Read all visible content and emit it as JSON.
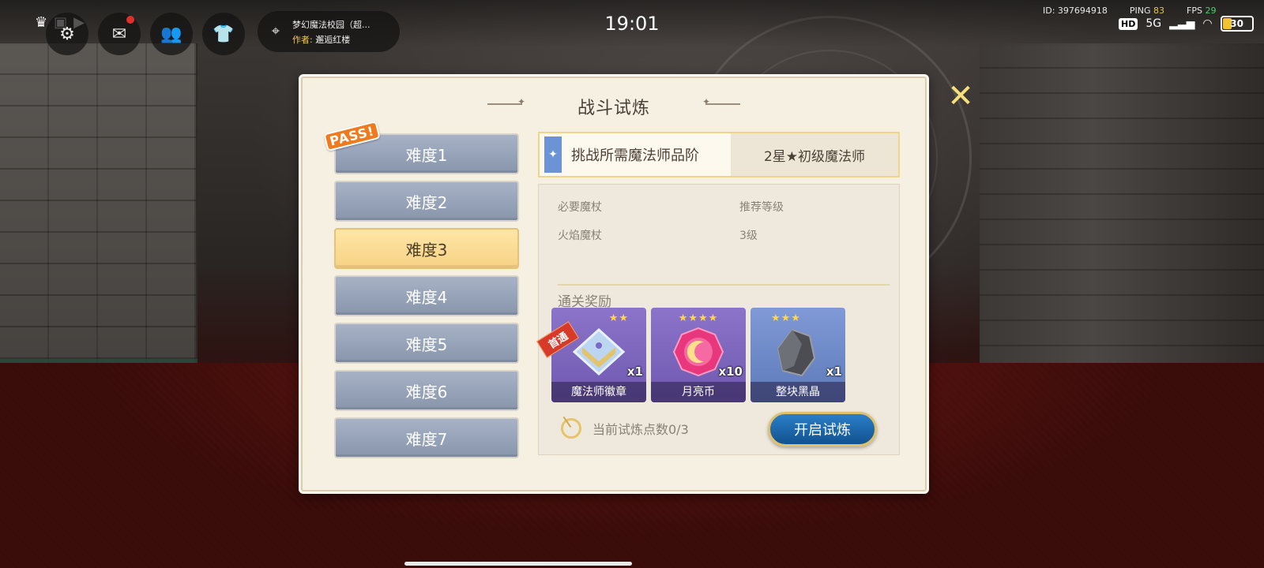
{
  "status_bar": {
    "clock": "19:01",
    "user_id": "ID: 397694918",
    "ping_label": "PING",
    "ping_value": "83",
    "fps_label": "FPS",
    "fps_value": "29",
    "network": "5G",
    "hd_badge": "HD",
    "battery": "30"
  },
  "map_info": {
    "map_name": "梦幻魔法校园（超...",
    "author_key": "作者:",
    "author_name": "邂逅红楼"
  },
  "panel": {
    "title": "战斗试炼",
    "pass_badge": "PASS!",
    "difficulties": [
      "难度1",
      "难度2",
      "难度3",
      "难度4",
      "难度5",
      "难度6",
      "难度7"
    ],
    "selected_index": 2,
    "requirement_label": "挑战所需魔法师品阶",
    "requirement_value": "2星★初级魔法师",
    "info": {
      "required_wand_label": "必要魔杖",
      "recommended_level_label": "推荐等级",
      "required_wand_value": "火焰魔杖",
      "recommended_level_value": "3级"
    },
    "rewards_title": "通关奖励",
    "rewards": [
      {
        "name": "魔法师徽章",
        "count": "x1",
        "stars": "★★",
        "first_clear": "首通"
      },
      {
        "name": "月亮币",
        "count": "x10",
        "stars": "★★★★"
      },
      {
        "name": "整块黑晶",
        "count": "x1",
        "stars": "★★★"
      }
    ],
    "trial_points": "当前试炼点数0/3",
    "start_button": "开启试炼"
  },
  "colors": {
    "selected_difficulty": "#f7d285",
    "difficulty_default": "#8895ab",
    "start_button": "#12528f",
    "panel_bg": "#f6f0e2"
  }
}
